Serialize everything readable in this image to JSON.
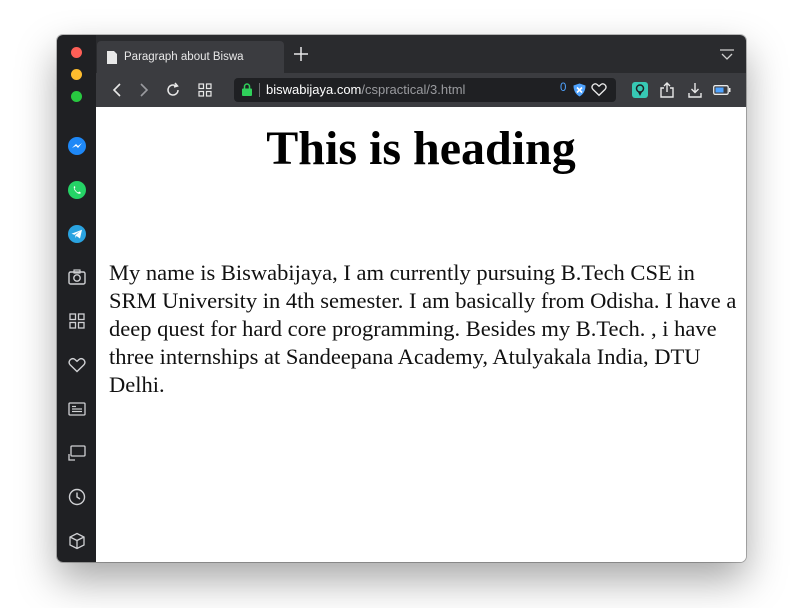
{
  "browser": {
    "tab": {
      "title": "Paragraph about Biswa"
    },
    "address": {
      "domain": "biswabijaya.com",
      "path": "/cspractical/3.html"
    },
    "adblock_count": "0"
  },
  "sidebar_icons": [
    "messenger-icon",
    "whatsapp-icon",
    "telegram-icon",
    "camera-icon",
    "speed-dial-icon",
    "heart-icon",
    "news-icon",
    "player-icon",
    "history-icon",
    "extensions-icon"
  ],
  "page": {
    "heading": "This is heading",
    "paragraph": "My name is Biswabijaya, I am currently pursuing B.Tech CSE in SRM University in 4th semester. I am basically from Odisha. I have a deep quest for hard core programming. Besides my B.Tech. , i have three internships at Sandeepana Academy, Atulyakala India, DTU Delhi."
  },
  "colors": {
    "sidebar": "#1f2023",
    "toolbar": "#3b3c40",
    "accent": "#4fa3ff"
  }
}
